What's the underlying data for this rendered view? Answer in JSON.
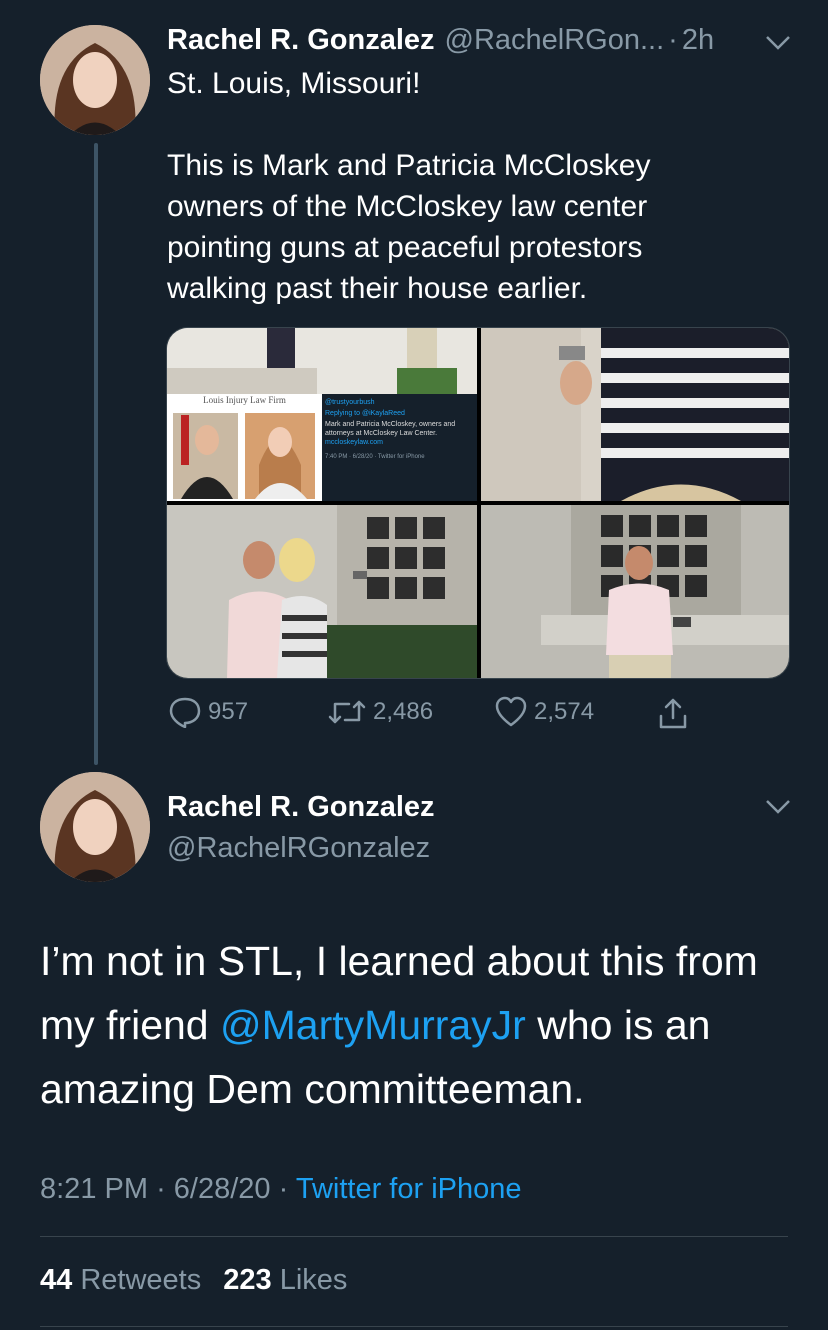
{
  "colors": {
    "background": "#15202b",
    "muted": "#8899a6",
    "link": "#1da1f2",
    "divider": "#38444d"
  },
  "parent_tweet": {
    "author_name": "Rachel R. Gonzalez",
    "handle_truncated": "@RachelRGon...",
    "separator": "·",
    "time_ago": "2h",
    "text": "St. Louis, Missouri!\n\nThis is Mark and Patricia McCloskey\nowners of the McCloskey law center\npointing guns at peaceful protestors\nwalking past their house earlier.",
    "media": {
      "embedded_screenshot": {
        "header": "Louis Injury Law Firm",
        "handle": "@trustyourbush",
        "replying": "Replying to @iKaylaReed",
        "text": "Mark and Patricia McCloskey, owners and attorneys at McCloskey Law Center.",
        "link": "mccloskeylaw.com",
        "footer": "7:40 PM · 6/28/20 · Twitter for iPhone"
      }
    },
    "actions": {
      "replies": "957",
      "retweets": "2,486",
      "likes": "2,574"
    },
    "icons": [
      "reply-icon",
      "retweet-icon",
      "like-icon",
      "share-icon",
      "chevron-down-icon"
    ]
  },
  "main_tweet": {
    "author_name": "Rachel R. Gonzalez",
    "handle": "@RachelRGonzalez",
    "text_part1": "I’m not in STL, I learned about this from my friend ",
    "mention": "@MartyMurrayJr",
    "text_part2": " who is an amazing Dem committeeman.",
    "time": "8:21 PM",
    "date": "6/28/20",
    "separator": "·",
    "source": "Twitter for iPhone",
    "retweet_count": "44",
    "retweet_label": "Retweets",
    "like_count": "223",
    "like_label": "Likes"
  }
}
